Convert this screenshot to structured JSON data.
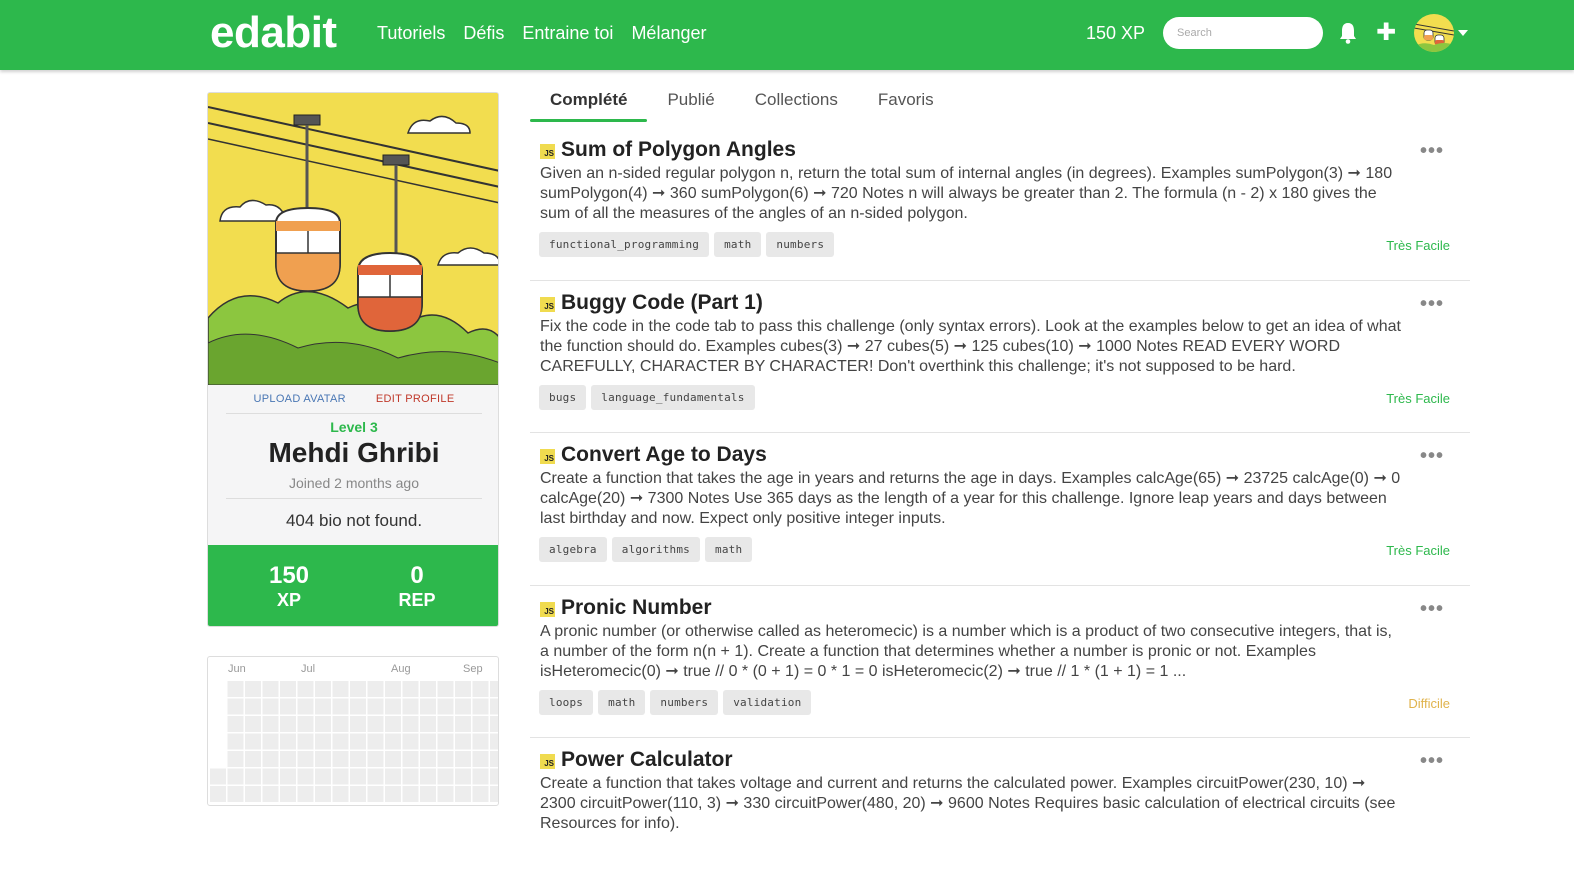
{
  "nav": {
    "logo": "edabit",
    "links": [
      "Tutoriels",
      "Défis",
      "Entraine toi",
      "Mélanger"
    ],
    "xp": "150 XP",
    "search_placeholder": "Search"
  },
  "profile": {
    "upload_avatar": "UPLOAD AVATAR",
    "edit_profile": "EDIT PROFILE",
    "level": "Level 3",
    "name": "Mehdi Ghribi",
    "joined": "Joined 2 months ago",
    "bio": "404 bio not found.",
    "xp_value": "150",
    "xp_label": "XP",
    "rep_value": "0",
    "rep_label": "REP"
  },
  "calendar": {
    "months": [
      "Jun",
      "Jul",
      "Aug",
      "Sep"
    ],
    "active_color": "#2db84c"
  },
  "tabs": [
    "Complété",
    "Publié",
    "Collections",
    "Favoris"
  ],
  "active_tab": "Complété",
  "challenges": [
    {
      "language": "JS",
      "title": "Sum of Polygon Angles",
      "description": "Given an n-sided regular polygon n, return the total sum of internal angles (in degrees). Examples sumPolygon(3) ➞ 180 sumPolygon(4) ➞ 360 sumPolygon(6) ➞ 720 Notes n will always be greater than 2. The formula (n - 2) x 180 gives the sum of all the measures of the angles of an n-sided polygon.",
      "tags": [
        "functional_programming",
        "math",
        "numbers"
      ],
      "difficulty": "Très Facile"
    },
    {
      "language": "JS",
      "title": "Buggy Code (Part 1)",
      "description": "Fix the code in the code tab to pass this challenge (only syntax errors). Look at the examples below to get an idea of what the function should do. Examples cubes(3) ➞ 27 cubes(5) ➞ 125 cubes(10) ➞ 1000 Notes READ EVERY WORD CAREFULLY, CHARACTER BY CHARACTER! Don't overthink this challenge; it's not supposed to be hard.",
      "tags": [
        "bugs",
        "language_fundamentals"
      ],
      "difficulty": "Très Facile"
    },
    {
      "language": "JS",
      "title": "Convert Age to Days",
      "description": "Create a function that takes the age in years and returns the age in days. Examples calcAge(65) ➞ 23725 calcAge(0) ➞ 0 calcAge(20) ➞ 7300 Notes Use 365 days as the length of a year for this challenge. Ignore leap years and days between last birthday and now. Expect only positive integer inputs.",
      "tags": [
        "algebra",
        "algorithms",
        "math"
      ],
      "difficulty": "Très Facile"
    },
    {
      "language": "JS",
      "title": "Pronic Number",
      "description": "A pronic number (or otherwise called as heteromecic) is a number which is a product of two consecutive integers, that is, a number of the form n(n + 1). Create a function that determines whether a number is pronic or not. Examples isHeteromecic(0) ➞ true // 0 * (0 + 1) = 0 * 1 = 0 isHeteromecic(2) ➞ true // 1 * (1 + 1) = 1 ...",
      "tags": [
        "loops",
        "math",
        "numbers",
        "validation"
      ],
      "difficulty": "Difficile"
    },
    {
      "language": "JS",
      "title": "Power Calculator",
      "description": "Create a function that takes voltage and current and returns the calculated power. Examples circuitPower(230, 10) ➞ 2300 circuitPower(110, 3) ➞ 330 circuitPower(480, 20) ➞ 9600 Notes Requires basic calculation of electrical circuits (see Resources for info).",
      "tags": [],
      "difficulty": ""
    }
  ]
}
